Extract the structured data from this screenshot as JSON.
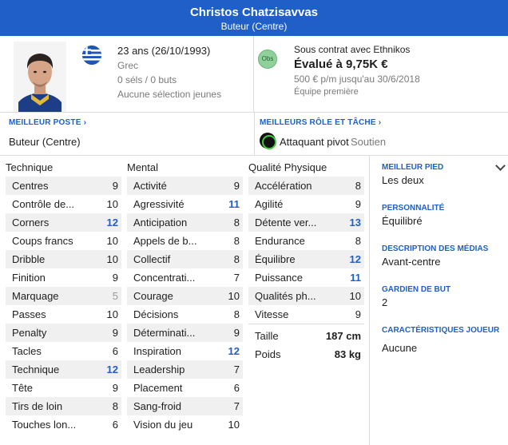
{
  "header": {
    "name": "Christos Chatzisavvas",
    "role": "Buteur (Centre)"
  },
  "bio": {
    "age": "23 ans (26/10/1993)",
    "nationality": "Grec",
    "caps": "0 séls / 0 buts",
    "youth": "Aucune sélection jeunes",
    "flag_icon": "greece-flag-icon"
  },
  "contract": {
    "badge": "Obs",
    "status": "Sous contrat avec Ethnikos",
    "value": "Évalué à 9,75K €",
    "wage": "500 € p/m jusqu'au 30/6/2018",
    "squad": "Équipe première"
  },
  "best_position": {
    "heading": "MEILLEUR POSTE",
    "value": "Buteur (Centre)"
  },
  "best_role": {
    "heading": "MEILLEURS RÔLE ET TÂCHE",
    "role": "Attaquant pivot",
    "duty": "Soutien"
  },
  "columns": {
    "technical": "Technique",
    "mental": "Mental",
    "physical": "Qualité Physique"
  },
  "technical": [
    {
      "label": "Centres",
      "value": "9"
    },
    {
      "label": "Contrôle de...",
      "value": "10"
    },
    {
      "label": "Corners",
      "value": "12"
    },
    {
      "label": "Coups francs",
      "value": "10"
    },
    {
      "label": "Dribble",
      "value": "10"
    },
    {
      "label": "Finition",
      "value": "9"
    },
    {
      "label": "Marquage",
      "value": "5"
    },
    {
      "label": "Passes",
      "value": "10"
    },
    {
      "label": "Penalty",
      "value": "9"
    },
    {
      "label": "Tacles",
      "value": "6"
    },
    {
      "label": "Technique",
      "value": "12"
    },
    {
      "label": "Tête",
      "value": "9"
    },
    {
      "label": "Tirs de loin",
      "value": "8"
    },
    {
      "label": "Touches lon...",
      "value": "6"
    }
  ],
  "mental": [
    {
      "label": "Activité",
      "value": "9"
    },
    {
      "label": "Agressivité",
      "value": "11"
    },
    {
      "label": "Anticipation",
      "value": "8"
    },
    {
      "label": "Appels de b...",
      "value": "8"
    },
    {
      "label": "Collectif",
      "value": "8"
    },
    {
      "label": "Concentrati...",
      "value": "7"
    },
    {
      "label": "Courage",
      "value": "10"
    },
    {
      "label": "Décisions",
      "value": "8"
    },
    {
      "label": "Déterminati...",
      "value": "9"
    },
    {
      "label": "Inspiration",
      "value": "12"
    },
    {
      "label": "Leadership",
      "value": "7"
    },
    {
      "label": "Placement",
      "value": "6"
    },
    {
      "label": "Sang-froid",
      "value": "7"
    },
    {
      "label": "Vision du jeu",
      "value": "10"
    }
  ],
  "physical": [
    {
      "label": "Accélération",
      "value": "8"
    },
    {
      "label": "Agilité",
      "value": "9"
    },
    {
      "label": "Détente ver...",
      "value": "13"
    },
    {
      "label": "Endurance",
      "value": "8"
    },
    {
      "label": "Équilibre",
      "value": "12"
    },
    {
      "label": "Puissance",
      "value": "11"
    },
    {
      "label": "Qualités ph...",
      "value": "10"
    },
    {
      "label": "Vitesse",
      "value": "9"
    }
  ],
  "measures": {
    "height_label": "Taille",
    "height": "187 cm",
    "weight_label": "Poids",
    "weight": "83 kg"
  },
  "side": {
    "foot_h": "MEILLEUR PIED",
    "foot": "Les deux",
    "pers_h": "PERSONNALITÉ",
    "pers": "Équilibré",
    "media_h": "DESCRIPTION DES MÉDIAS",
    "media": "Avant-centre",
    "gk_h": "GARDIEN DE BUT",
    "gk": "2",
    "traits_h": "CARACTÉRISTIQUES JOUEUR",
    "traits": "Aucune"
  }
}
